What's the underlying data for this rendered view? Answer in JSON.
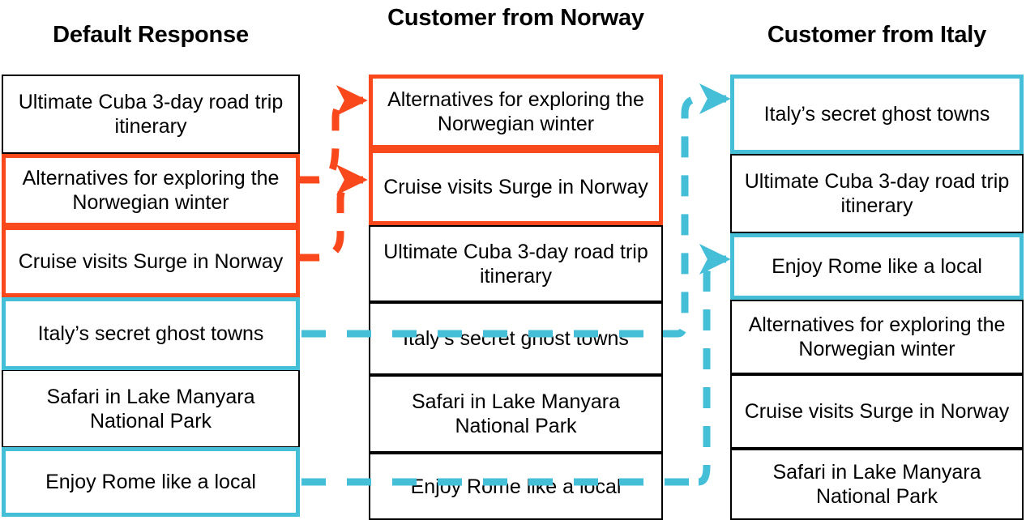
{
  "colors": {
    "orange": "#F9481C",
    "cyan": "#45BFD8",
    "black": "#000000",
    "background": "#FFFFFF"
  },
  "columns": [
    {
      "id": "default-response",
      "title": "Default Response",
      "items": [
        {
          "label": "Ultimate Cuba 3-day road trip itinerary",
          "highlight": "none"
        },
        {
          "label": "Alternatives for exploring the Norwegian winter",
          "highlight": "orange"
        },
        {
          "label": "Cruise visits Surge in Norway",
          "highlight": "orange"
        },
        {
          "label": "Italy’s secret ghost towns",
          "highlight": "cyan"
        },
        {
          "label": "Safari in Lake Manyara National Park",
          "highlight": "none"
        },
        {
          "label": "Enjoy Rome like a local",
          "highlight": "cyan"
        }
      ]
    },
    {
      "id": "customer-from-norway",
      "title": "Customer from Norway",
      "items": [
        {
          "label": "Alternatives for exploring the Norwegian winter",
          "highlight": "orange"
        },
        {
          "label": "Cruise visits Surge in Norway",
          "highlight": "orange"
        },
        {
          "label": "Ultimate Cuba 3-day road trip itinerary",
          "highlight": "none"
        },
        {
          "label": "Italy’s secret ghost towns",
          "highlight": "none"
        },
        {
          "label": "Safari in Lake Manyara National Park",
          "highlight": "none"
        },
        {
          "label": "Enjoy Rome like a local",
          "highlight": "none"
        }
      ]
    },
    {
      "id": "customer-from-italy",
      "title": "Customer from Italy",
      "items": [
        {
          "label": "Italy’s secret ghost towns",
          "highlight": "cyan"
        },
        {
          "label": "Ultimate Cuba 3-day road trip itinerary",
          "highlight": "none"
        },
        {
          "label": "Enjoy Rome like a local",
          "highlight": "cyan"
        },
        {
          "label": "Alternatives for exploring the Norwegian winter",
          "highlight": "none"
        },
        {
          "label": "Cruise visits Surge in Norway",
          "highlight": "none"
        },
        {
          "label": "Safari in Lake Manyara National Park",
          "highlight": "none"
        }
      ]
    }
  ],
  "connectors": [
    {
      "id": "orange-alternatives",
      "color": "#F9481C",
      "style": "dashed-arrow",
      "from": "default-response.item.1",
      "to": "customer-from-norway.item.0"
    },
    {
      "id": "orange-cruise",
      "color": "#F9481C",
      "style": "dashed-arrow",
      "from": "default-response.item.2",
      "to": "customer-from-norway.item.1"
    },
    {
      "id": "cyan-italy-col1-col2",
      "color": "#45BFD8",
      "style": "dashed",
      "from": "default-response.item.3",
      "to": "customer-from-norway.item.3"
    },
    {
      "id": "cyan-rome-col1-col2",
      "color": "#45BFD8",
      "style": "dashed",
      "from": "default-response.item.5",
      "to": "customer-from-norway.item.5"
    },
    {
      "id": "cyan-italy-col2-col3",
      "color": "#45BFD8",
      "style": "dashed-arrow",
      "from": "customer-from-norway.item.3",
      "to": "customer-from-italy.item.0"
    },
    {
      "id": "cyan-rome-col2-col3",
      "color": "#45BFD8",
      "style": "dashed-arrow",
      "from": "customer-from-norway.item.5",
      "to": "customer-from-italy.item.2"
    }
  ]
}
